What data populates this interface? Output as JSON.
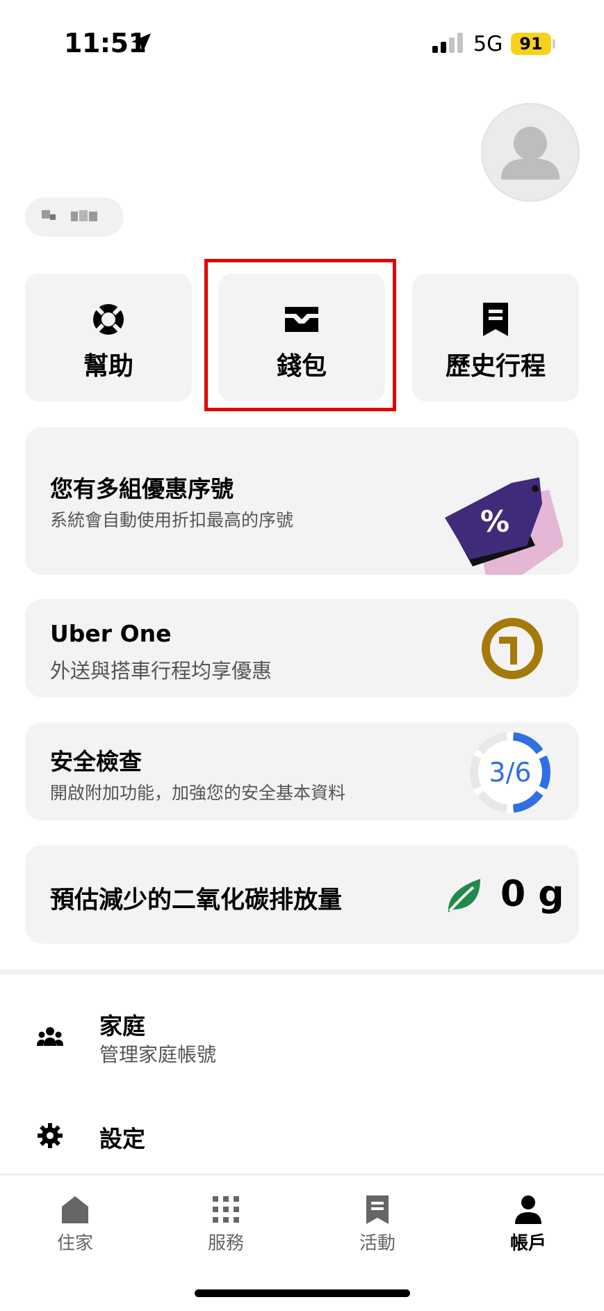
{
  "status_bar": {
    "time": "11:51",
    "network": "5G",
    "battery": "91"
  },
  "tiles": [
    {
      "label": "幫助",
      "icon": "lifebuoy-icon"
    },
    {
      "label": "錢包",
      "icon": "wallet-icon"
    },
    {
      "label": "歷史行程",
      "icon": "receipt-icon"
    }
  ],
  "promo_card": {
    "title": "您有多組優惠序號",
    "subtitle": "系統會自動使用折扣最高的序號",
    "icon": "percent-tag-icon"
  },
  "uber_one_card": {
    "title": "Uber One",
    "subtitle": "外送與搭車行程均享優惠",
    "icon": "uber-one-icon"
  },
  "safety_card": {
    "title": "安全檢查",
    "subtitle": "開啟附加功能，加強您的安全基本資料",
    "progress_text": "3/6",
    "progress_fraction": 0.5
  },
  "co2_card": {
    "title": "預估減少的二氧化碳排放量",
    "value": "0 g",
    "icon": "leaf-icon"
  },
  "list": [
    {
      "title": "家庭",
      "subtitle": "管理家庭帳號",
      "icon": "family-icon"
    },
    {
      "title": "設定",
      "icon": "gear-icon"
    }
  ],
  "bottom_nav": [
    {
      "label": "住家",
      "icon": "home-icon"
    },
    {
      "label": "服務",
      "icon": "grid-icon"
    },
    {
      "label": "活動",
      "icon": "receipt-icon"
    },
    {
      "label": "帳戶",
      "icon": "person-icon",
      "active": true
    }
  ],
  "colors": {
    "highlight": "#e00000",
    "progress": "#2f6fe4",
    "uber_one": "#a57a0b",
    "leaf": "#1f8a4a",
    "battery": "#f7d21c"
  }
}
